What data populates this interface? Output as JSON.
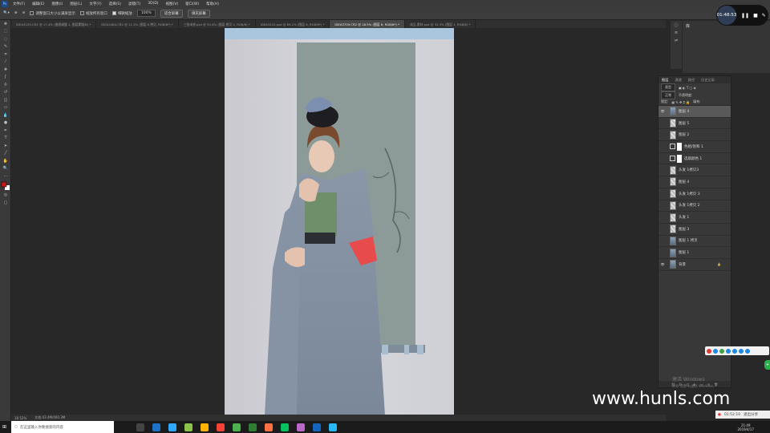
{
  "menubar": {
    "items": [
      "文件(F)",
      "编辑(E)",
      "图像(I)",
      "图层(L)",
      "文字(Y)",
      "选择(S)",
      "滤镜(T)",
      "3D(D)",
      "视图(V)",
      "窗口(W)",
      "帮助(H)"
    ]
  },
  "options": {
    "resize_windows": "调整窗口大小以满屏显示",
    "zoom_all": "缩放所有窗口",
    "scrubby_zoom": "细微缩放",
    "zoom_value": "100%",
    "fit_screen": "适合屏幕",
    "fill_screen": "填充屏幕"
  },
  "tabs": [
    "IDEA3229.CR2 @ 17.4% (曲线调整 1, 图层蒙版/8) *",
    "IDEA2464.CR2 @ 11.2% (图层 8 拷贝, RGB/8*) *",
    "三张未修.psd @ 30.4% (图层 拷贝 2, RGB/8) *",
    "IDEA3210.psd @ 89.2% (图层 6, RGB/8*) *",
    "IDEA3709.CR2 @ 18.5% (图层 6, RGB/8*) *",
    "成品 素材.psd @ 33.3% (图层 1, RGB/8) *"
  ],
  "active_tab_index": 4,
  "status": {
    "zoom": "18.52%",
    "doc": "文档:43.4M/400.3M"
  },
  "recording": {
    "time": "01:48:53"
  },
  "layers_panel": {
    "tabs": [
      "图层",
      "通道",
      "路径",
      "历史记录"
    ],
    "kind_label": "类型",
    "blend_mode": "正常",
    "opacity_label": "不透明度:",
    "lock_label": "锁定:",
    "fill_label": "填充:",
    "layers": [
      {
        "name": "图层 4",
        "thumb": "photo",
        "selected": true,
        "visible": true
      },
      {
        "name": "图层 5",
        "thumb": "transparent",
        "selected": false,
        "visible": false
      },
      {
        "name": "图层 2",
        "thumb": "transparent",
        "selected": false,
        "visible": false
      },
      {
        "name": "色相/饱和 1",
        "thumb": "adjust",
        "selected": false,
        "visible": false
      },
      {
        "name": "选取颜色 1",
        "thumb": "adjust",
        "selected": false,
        "visible": false
      },
      {
        "name": "头发 1拷贝3",
        "thumb": "transparent",
        "selected": false,
        "visible": false
      },
      {
        "name": "图层 4",
        "thumb": "transparent",
        "selected": false,
        "visible": false
      },
      {
        "name": "头发 1拷贝 3",
        "thumb": "transparent",
        "selected": false,
        "visible": false
      },
      {
        "name": "头发 1拷贝 2",
        "thumb": "transparent",
        "selected": false,
        "visible": false
      },
      {
        "name": "头发 1",
        "thumb": "transparent",
        "selected": false,
        "visible": false
      },
      {
        "name": "图层 3",
        "thumb": "transparent",
        "selected": false,
        "visible": false
      },
      {
        "name": "图层 1 拷贝",
        "thumb": "photo",
        "selected": false,
        "visible": false
      },
      {
        "name": "图层 1",
        "thumb": "photo",
        "selected": false,
        "visible": false
      },
      {
        "name": "背景",
        "thumb": "photo",
        "selected": false,
        "visible": true,
        "locked": true
      }
    ]
  },
  "side_panel": {
    "title": "库"
  },
  "windows_activation": {
    "line1": "激活 Windows",
    "line2": "转到\"设置\"以激活 Windows。"
  },
  "watermark": "www.hunls.com",
  "recorder_bar": {
    "time": "01:52:10",
    "exit": "退出分享"
  },
  "taskbar": {
    "search_placeholder": "在这里输入你要搜索的内容",
    "clock_time": "21:49",
    "clock_date": "2019/4/17"
  }
}
